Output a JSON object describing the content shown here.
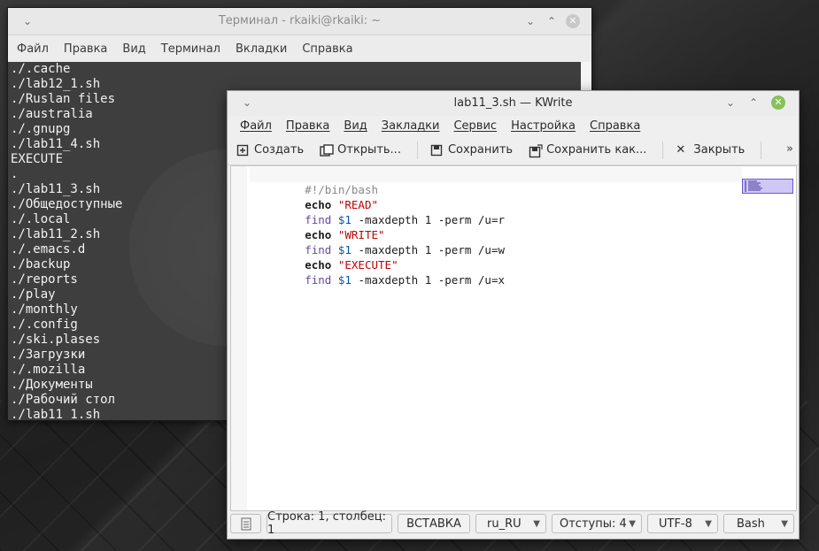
{
  "terminal": {
    "title": "Терминал - rkaiki@rkaiki: ~",
    "menu": [
      "Файл",
      "Правка",
      "Вид",
      "Терминал",
      "Вкладки",
      "Справка"
    ],
    "lines": [
      "./.cache",
      "./lab12_1.sh",
      "./Ruslan files",
      "./australia",
      "./.gnupg",
      "./lab11_4.sh",
      "EXECUTE",
      ".",
      "./lab11_3.sh",
      "./Общедоступные",
      "./.local",
      "./lab11_2.sh",
      "./.emacs.d",
      "./backup",
      "./reports",
      "./play",
      "./monthly",
      "./.config",
      "./ski.plases",
      "./Загрузки",
      "./.mozilla",
      "./Документы",
      "./Рабочий стол",
      "./lab11_1.sh"
    ]
  },
  "kwrite": {
    "title": "lab11_3.sh — KWrite",
    "menu": [
      "Файл",
      "Правка",
      "Вид",
      "Закладки",
      "Сервис",
      "Настройка",
      "Справка"
    ],
    "toolbar": {
      "new": "Создать",
      "open": "Открыть...",
      "save": "Сохранить",
      "save_as": "Сохранить как...",
      "close": "Закрыть",
      "more": "»"
    },
    "code": {
      "shebang": "#!/bin/bash",
      "echo": "echo",
      "find": "find",
      "var": "$1",
      "args_r": " -maxdepth 1 -perm /u=r",
      "args_w": " -maxdepth 1 -perm /u=w",
      "args_x": " -maxdepth 1 -perm /u=x",
      "str_read": "\"READ\"",
      "str_write": "\"WRITE\"",
      "str_execute": "\"EXECUTE\""
    },
    "status": {
      "position": "Строка: 1, столбец: 1",
      "mode": "ВСТАВКА",
      "language": "ru_RU",
      "indent": "Отступы: 4",
      "encoding": "UTF-8",
      "syntax": "Bash"
    }
  }
}
